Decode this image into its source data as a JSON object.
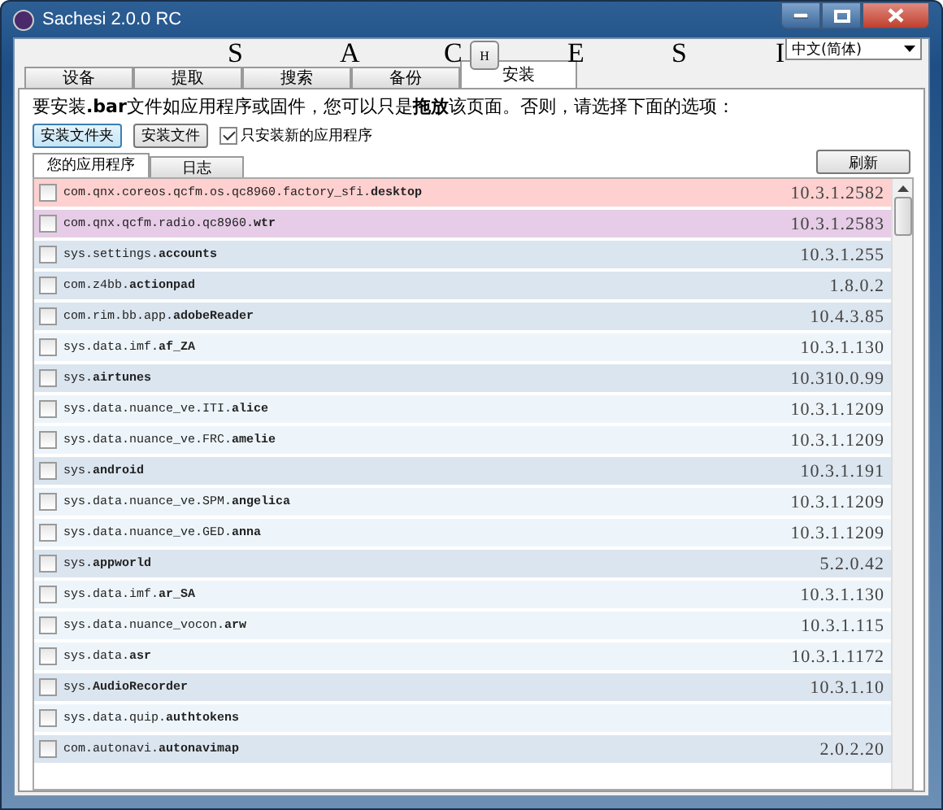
{
  "window": {
    "title": "Sachesi 2.0.0 RC"
  },
  "banner": {
    "letters_left": [
      "S",
      "A",
      "C"
    ],
    "button": "H",
    "letters_right": [
      "E",
      "S",
      "I"
    ]
  },
  "language": {
    "value": "中文(简体)"
  },
  "tabs": [
    {
      "label": "设备",
      "selected": false
    },
    {
      "label": "提取",
      "selected": false
    },
    {
      "label": "搜索",
      "selected": false
    },
    {
      "label": "备份",
      "selected": false
    },
    {
      "label": "安装",
      "selected": true
    }
  ],
  "instructions": "要安装**.bar**文件如应用程序或固件，您可以只是**拖放**该页面。否则，请选择下面的选项：",
  "buttons": [
    {
      "label": "安装文件夹",
      "selected": true
    },
    {
      "label": "安装文件",
      "selected": false
    }
  ],
  "only_new": {
    "label": "只安装新的应用程序",
    "checked": true
  },
  "subtabs": [
    {
      "label": "您的应用程序",
      "selected": true
    },
    {
      "label": "日志",
      "selected": false
    }
  ],
  "refresh": "刷新",
  "apps": [
    {
      "name": "com.qnx.coreos.qcfm.os.qc8960.factory_sfi.**desktop**",
      "version": "10.3.1.2582",
      "checked": false,
      "color": "#ffd0d0"
    },
    {
      "name": "com.qnx.qcfm.radio.qc8960.**wtr**",
      "version": "10.3.1.2583",
      "checked": false,
      "color": "#e6cce6"
    },
    {
      "name": "sys.settings.**accounts**",
      "version": "10.3.1.255",
      "checked": false,
      "color": "#dbe5ef"
    },
    {
      "name": "com.z4bb.**actionpad**",
      "version": "1.8.0.2",
      "checked": false,
      "color": "#dbe5ef"
    },
    {
      "name": "com.rim.bb.app.**adobeReader**",
      "version": "10.4.3.85",
      "checked": false,
      "color": "#dbe5ef"
    },
    {
      "name": "sys.data.imf.**af_ZA**",
      "version": "10.3.1.130",
      "checked": false,
      "color": "#eef5fa"
    },
    {
      "name": "sys.**airtunes**",
      "version": "10.310.0.99",
      "checked": false,
      "color": "#dbe5ef"
    },
    {
      "name": "sys.data.nuance_ve.ITI.**alice**",
      "version": "10.3.1.1209",
      "checked": false,
      "color": "#eef5fa"
    },
    {
      "name": "sys.data.nuance_ve.FRC.**amelie**",
      "version": "10.3.1.1209",
      "checked": false,
      "color": "#eef5fa"
    },
    {
      "name": "sys.**android**",
      "version": "10.3.1.191",
      "checked": false,
      "color": "#dbe5ef"
    },
    {
      "name": "sys.data.nuance_ve.SPM.**angelica**",
      "version": "10.3.1.1209",
      "checked": false,
      "color": "#eef5fa"
    },
    {
      "name": "sys.data.nuance_ve.GED.**anna**",
      "version": "10.3.1.1209",
      "checked": false,
      "color": "#eef5fa"
    },
    {
      "name": "sys.**appworld**",
      "version": "5.2.0.42",
      "checked": false,
      "color": "#dbe5ef"
    },
    {
      "name": "sys.data.imf.**ar_SA**",
      "version": "10.3.1.130",
      "checked": false,
      "color": "#eef5fa"
    },
    {
      "name": "sys.data.nuance_vocon.**arw**",
      "version": "10.3.1.115",
      "checked": false,
      "color": "#eef5fa"
    },
    {
      "name": "sys.data.**asr**",
      "version": "10.3.1.1172",
      "checked": false,
      "color": "#eef5fa"
    },
    {
      "name": "sys.**AudioRecorder**",
      "version": "10.3.1.10",
      "checked": false,
      "color": "#dbe5ef"
    },
    {
      "name": "sys.data.quip.**authtokens**",
      "checked": false,
      "color": "#eef5fa"
    },
    {
      "name": "com.autonavi.**autonavimap**",
      "version": "2.0.2.20",
      "checked": false,
      "color": "#dbe5ef"
    }
  ]
}
